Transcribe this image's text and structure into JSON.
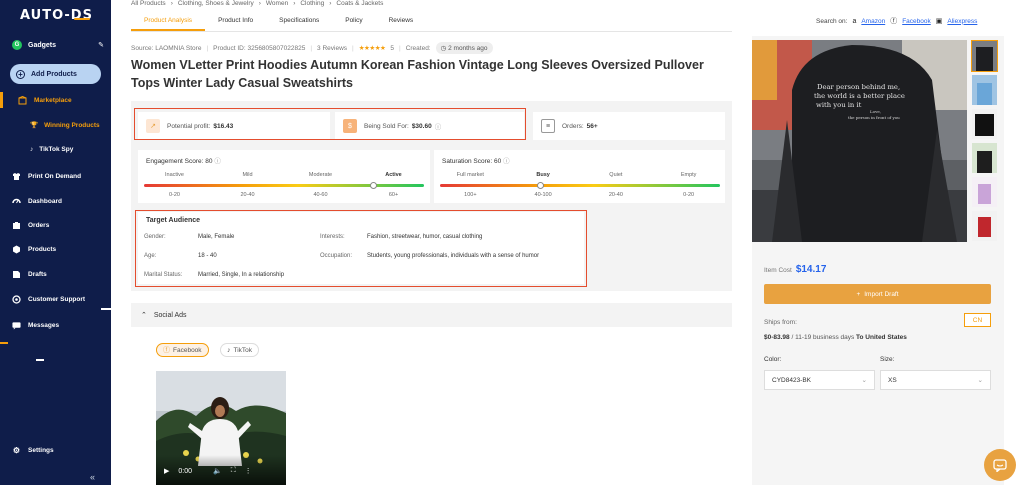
{
  "brand": {
    "logo": "AUTO-DS"
  },
  "store": {
    "avatar_letter": "G",
    "name": "Gadgets"
  },
  "sidebar": {
    "add_products": "Add Products",
    "marketplace": "Marketplace",
    "winning_products": "Winning Products",
    "tiktok_spy": "TikTok Spy",
    "items": [
      {
        "label": "Print On Demand",
        "icon": "shirt-icon"
      },
      {
        "label": "Dashboard",
        "icon": "dashboard-icon"
      },
      {
        "label": "Orders",
        "icon": "orders-icon"
      },
      {
        "label": "Products",
        "icon": "products-icon"
      },
      {
        "label": "Drafts",
        "icon": "drafts-icon"
      },
      {
        "label": "Customer Support",
        "icon": "support-icon"
      },
      {
        "label": "Messages",
        "icon": "messages-icon"
      }
    ],
    "settings": "Settings"
  },
  "breadcrumb": [
    "All Products",
    "Clothing, Shoes & Jewelry",
    "Women",
    "Clothing",
    "Coats & Jackets"
  ],
  "tabs": [
    "Product Analysis",
    "Product Info",
    "Specifications",
    "Policy",
    "Reviews"
  ],
  "search_on": {
    "label": "Search on:",
    "links": [
      "Amazon",
      "Facebook",
      "Aliexpress"
    ]
  },
  "meta": {
    "source": "Source: LAOMNIA Store",
    "product_id": "Product ID: 3256805807022825",
    "reviews": "3 Reviews",
    "stars": "★★★★★",
    "rating": "5",
    "created_label": "Created:",
    "created_value": "2 months ago"
  },
  "product_title": "Women VLetter Print Hoodies Autumn Korean Fashion Vintage Long Sleeves Oversized Pullover Tops Winter Lady Casual Sweatshirts",
  "stats": {
    "potential_profit_label": "Potential profit:",
    "potential_profit_value": "$16.43",
    "sold_for_label": "Being Sold For:",
    "sold_for_value": "$30.60",
    "orders_label": "Orders:",
    "orders_value": "56+"
  },
  "engagement": {
    "title": "Engagement Score: 80",
    "levels": [
      "Inactive",
      "Mild",
      "Moderate",
      "Active"
    ],
    "ranges": [
      "0-20",
      "20-40",
      "40-60",
      "60+"
    ],
    "active_index": 3,
    "level": 0.82
  },
  "saturation": {
    "title": "Saturation Score: 60",
    "levels": [
      "Full market",
      "Busy",
      "Quiet",
      "Empty"
    ],
    "ranges": [
      "100+",
      "40-100",
      "20-40",
      "0-20"
    ],
    "active_index": 1,
    "level": 0.36
  },
  "audience": {
    "title": "Target Audience",
    "gender_label": "Gender:",
    "gender_value": "Male, Female",
    "age_label": "Age:",
    "age_value": "18 - 40",
    "marital_label": "Marital Status:",
    "marital_value": "Married, Single, In a relationship",
    "interests_label": "Interests:",
    "interests_value": "Fashion, streetwear, humor, casual clothing",
    "occupation_label": "Occupation:",
    "occupation_value": "Students, young professionals, individuals with a sense of humor"
  },
  "social": {
    "title": "Social Ads",
    "chips": [
      "Facebook",
      "TikTok"
    ],
    "video_time": "0:00"
  },
  "hoodie_print": {
    "line1": "Dear person behind me,",
    "line2": "the world is a better place",
    "line3": "with you in it",
    "line4": "Love,",
    "line5": "the person in front of you"
  },
  "purchase": {
    "item_cost_label": "Item Cost",
    "item_cost_value": "$14.17",
    "import_label": "Import Draft",
    "cn_label": "CN",
    "ships_from_label": "Ships from:",
    "shipping_price": "$0-83.98",
    "shipping_days": "/ 11-19 business days",
    "shipping_to": "To United States",
    "color_label": "Color:",
    "color_value": "CYD8423-BK",
    "size_label": "Size:",
    "size_value": "XS"
  },
  "colors": {
    "accent": "#f59e0b",
    "sidebar": "#0f1d4a",
    "link": "#2563eb",
    "highlight_box": "#e44d2e"
  }
}
